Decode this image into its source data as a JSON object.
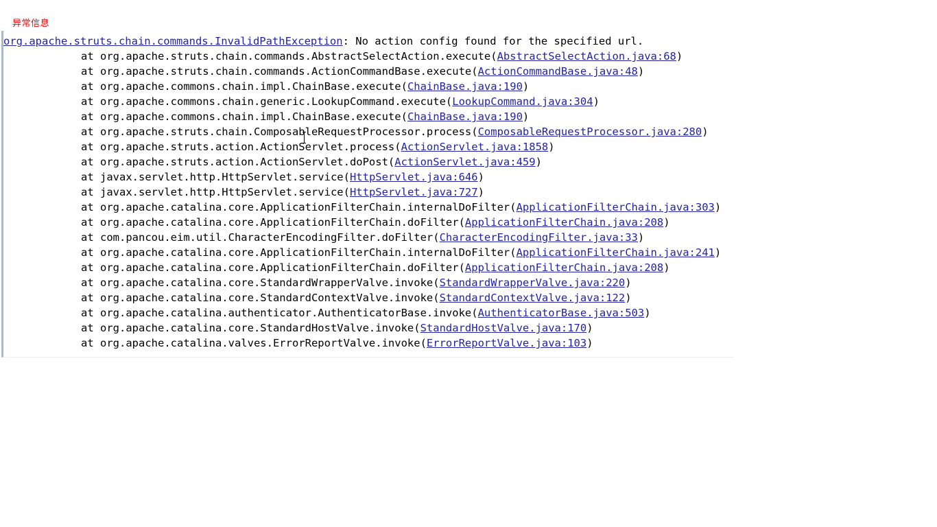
{
  "label": {
    "text": "异常信息",
    "color": "#ff0000"
  },
  "colors": {
    "link": "#2222aa",
    "text": "#000000",
    "panel_border": "#aab8cc",
    "background": "#ffffff"
  },
  "trace": {
    "clipped_top_line": {
      "prefix": "",
      "note_partially_scrolled_out": true
    },
    "header": {
      "exception_class": "org.apache.struts.chain.commands.InvalidPathException",
      "separator": ": ",
      "message": "No action config found for the specified url."
    },
    "frames": [
      {
        "at": "at ",
        "call": "org.apache.struts.chain.commands.AbstractSelectAction.execute(",
        "source": "AbstractSelectAction.java:68",
        "close": ")"
      },
      {
        "at": "at ",
        "call": "org.apache.struts.chain.commands.ActionCommandBase.execute(",
        "source": "ActionCommandBase.java:48",
        "close": ")"
      },
      {
        "at": "at ",
        "call": "org.apache.commons.chain.impl.ChainBase.execute(",
        "source": "ChainBase.java:190",
        "close": ")"
      },
      {
        "at": "at ",
        "call": "org.apache.commons.chain.generic.LookupCommand.execute(",
        "source": "LookupCommand.java:304",
        "close": ")"
      },
      {
        "at": "at ",
        "call": "org.apache.commons.chain.impl.ChainBase.execute(",
        "source": "ChainBase.java:190",
        "close": ")"
      },
      {
        "at": "at ",
        "call": "org.apache.struts.chain.ComposableRequestProcessor.process(",
        "source": "ComposableRequestProcessor.java:280",
        "close": ")"
      },
      {
        "at": "at ",
        "call": "org.apache.struts.action.ActionServlet.process(",
        "source": "ActionServlet.java:1858",
        "close": ")"
      },
      {
        "at": "at ",
        "call": "org.apache.struts.action.ActionServlet.doPost(",
        "source": "ActionServlet.java:459",
        "close": ")"
      },
      {
        "at": "at ",
        "call": "javax.servlet.http.HttpServlet.service(",
        "source": "HttpServlet.java:646",
        "close": ")"
      },
      {
        "at": "at ",
        "call": "javax.servlet.http.HttpServlet.service(",
        "source": "HttpServlet.java:727",
        "close": ")"
      },
      {
        "at": "at ",
        "call": "org.apache.catalina.core.ApplicationFilterChain.internalDoFilter(",
        "source": "ApplicationFilterChain.java:303",
        "close": ")"
      },
      {
        "at": "at ",
        "call": "org.apache.catalina.core.ApplicationFilterChain.doFilter(",
        "source": "ApplicationFilterChain.java:208",
        "close": ")"
      },
      {
        "at": "at ",
        "call": "com.pancou.eim.util.CharacterEncodingFilter.doFilter(",
        "source": "CharacterEncodingFilter.java:33",
        "close": ")"
      },
      {
        "at": "at ",
        "call": "org.apache.catalina.core.ApplicationFilterChain.internalDoFilter(",
        "source": "ApplicationFilterChain.java:241",
        "close": ")"
      },
      {
        "at": "at ",
        "call": "org.apache.catalina.core.ApplicationFilterChain.doFilter(",
        "source": "ApplicationFilterChain.java:208",
        "close": ")"
      },
      {
        "at": "at ",
        "call": "org.apache.catalina.core.StandardWrapperValve.invoke(",
        "source": "StandardWrapperValve.java:220",
        "close": ")"
      },
      {
        "at": "at ",
        "call": "org.apache.catalina.core.StandardContextValve.invoke(",
        "source": "StandardContextValve.java:122",
        "close": ")"
      },
      {
        "at": "at ",
        "call": "org.apache.catalina.authenticator.AuthenticatorBase.invoke(",
        "source": "AuthenticatorBase.java:503",
        "close": ")"
      },
      {
        "at": "at ",
        "call": "org.apache.catalina.core.StandardHostValve.invoke(",
        "source": "StandardHostValve.java:170",
        "close": ")"
      },
      {
        "at": "at ",
        "call": "org.apache.catalina.valves.ErrorReportValve.invoke(",
        "source": "ErrorReportValve.java:103",
        "close": ")"
      }
    ]
  }
}
